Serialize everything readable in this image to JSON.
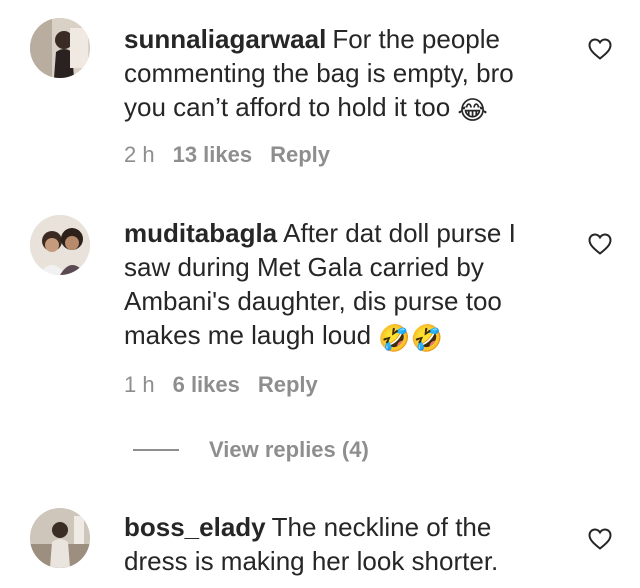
{
  "comments": [
    {
      "username": "sunnaliagarwaal",
      "text": "For the people commenting the bag is empty, bro you can’t afford to hold it too",
      "emoji": "😂",
      "time": "2 h",
      "likes": "13 likes",
      "reply": "Reply",
      "avatar_icon": "profile-photo"
    },
    {
      "username": "muditabagla",
      "text": "After dat doll purse I saw during Met Gala carried by Ambani's daughter, dis purse too makes me laugh loud",
      "emoji": "🤣🤣",
      "time": "1 h",
      "likes": "6 likes",
      "reply": "Reply",
      "avatar_icon": "profile-photo"
    },
    {
      "username": "boss_elady",
      "text": "The neckline of the dress is making her look shorter.",
      "emoji": "",
      "avatar_icon": "profile-photo"
    }
  ],
  "view_replies": "View replies (4)",
  "icons": {
    "like": "heart-outline-icon"
  },
  "colors": {
    "text": "#262626",
    "muted": "#8e8e8e"
  }
}
